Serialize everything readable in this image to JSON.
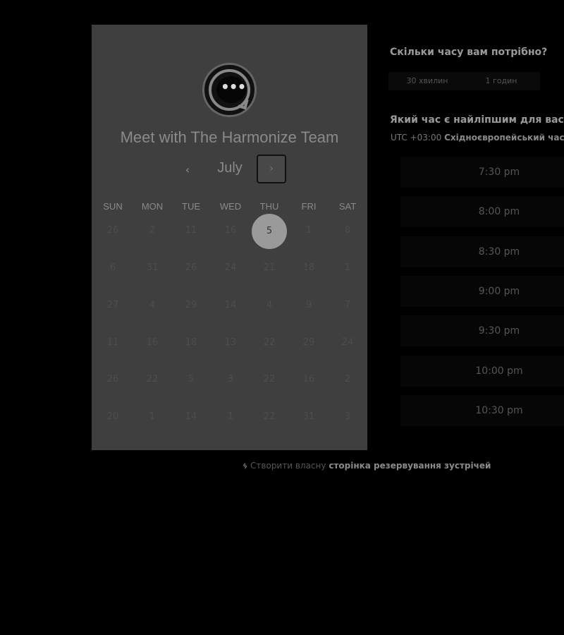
{
  "booking": {
    "title": "Meet with The Harmonize Team",
    "month": "July",
    "prev_icon": "‹",
    "next_icon": "›",
    "weekdays": [
      "SUN",
      "MON",
      "TUE",
      "WED",
      "THU",
      "FRI",
      "SAT"
    ],
    "weeks": [
      [
        "26",
        "2",
        "11",
        "16",
        "5",
        "1",
        "8"
      ],
      [
        "6",
        "31",
        "26",
        "24",
        "21",
        "18",
        "1"
      ],
      [
        "27",
        "4",
        "29",
        "14",
        "4",
        "9",
        "7"
      ],
      [
        "11",
        "16",
        "18",
        "13",
        "22",
        "29",
        "24"
      ],
      [
        "26",
        "22",
        "5",
        "3",
        "22",
        "16",
        "2"
      ],
      [
        "20",
        "1",
        "14",
        "1",
        "22",
        "31",
        "3"
      ]
    ],
    "selected_day": "5"
  },
  "duration": {
    "question": "Скільки часу вам потрібно?",
    "options": [
      "30 хвилин",
      "1 годин"
    ]
  },
  "time": {
    "question": "Який час є найліпшим для вас?",
    "tz_offset": "UTC +03:00",
    "tz_name": "Східноєвропейський час",
    "slots": [
      "7:30 pm",
      "8:00 pm",
      "8:30 pm",
      "9:00 pm",
      "9:30 pm",
      "10:00 pm",
      "10:30 pm"
    ]
  },
  "footer": {
    "icon": "sprocket-icon",
    "prefix": "Створити власну",
    "link": "сторінка резервування зустрічей"
  }
}
